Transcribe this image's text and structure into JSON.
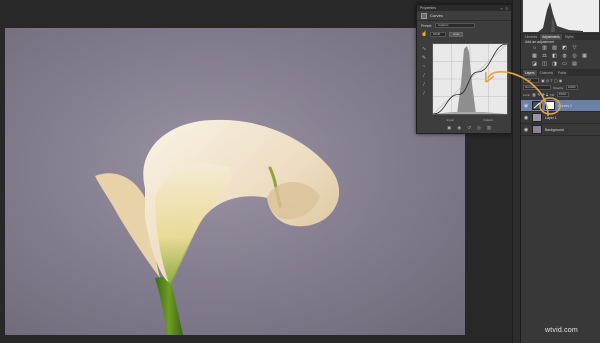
{
  "properties_panel": {
    "title": "Properties",
    "adjustment_name": "Curves",
    "preset_label": "Preset:",
    "preset_value": "Custom",
    "channel_value": "RGB",
    "auto_label": "Auto",
    "input_label": "Input:",
    "output_label": "Output:",
    "curve_points": [
      [
        0,
        0
      ],
      [
        0.35,
        0.28
      ],
      [
        0.6,
        0.6
      ],
      [
        1,
        1
      ]
    ]
  },
  "adjustments_panel": {
    "tabs": [
      "Libraries",
      "Adjustments",
      "Styles"
    ],
    "active_tab": "Adjustments",
    "subtitle": "Add an adjustment"
  },
  "layers_panel": {
    "tabs": [
      "Layers",
      "Channels",
      "Paths"
    ],
    "active_tab": "Layers",
    "kind_label": "Kind",
    "blend_mode": "Normal",
    "opacity_label": "Opacity:",
    "opacity_value": "100%",
    "lock_label": "Lock:",
    "fill_label": "Fill:",
    "fill_value": "100%",
    "layers": [
      {
        "name": "Curves 1",
        "selected": true
      },
      {
        "name": "Layer 1",
        "selected": false
      },
      {
        "name": "Background",
        "selected": false
      }
    ]
  },
  "annotation_color": "#e0a24a",
  "accent_selected": "#6b82a6",
  "watermark": "wtvid.com"
}
